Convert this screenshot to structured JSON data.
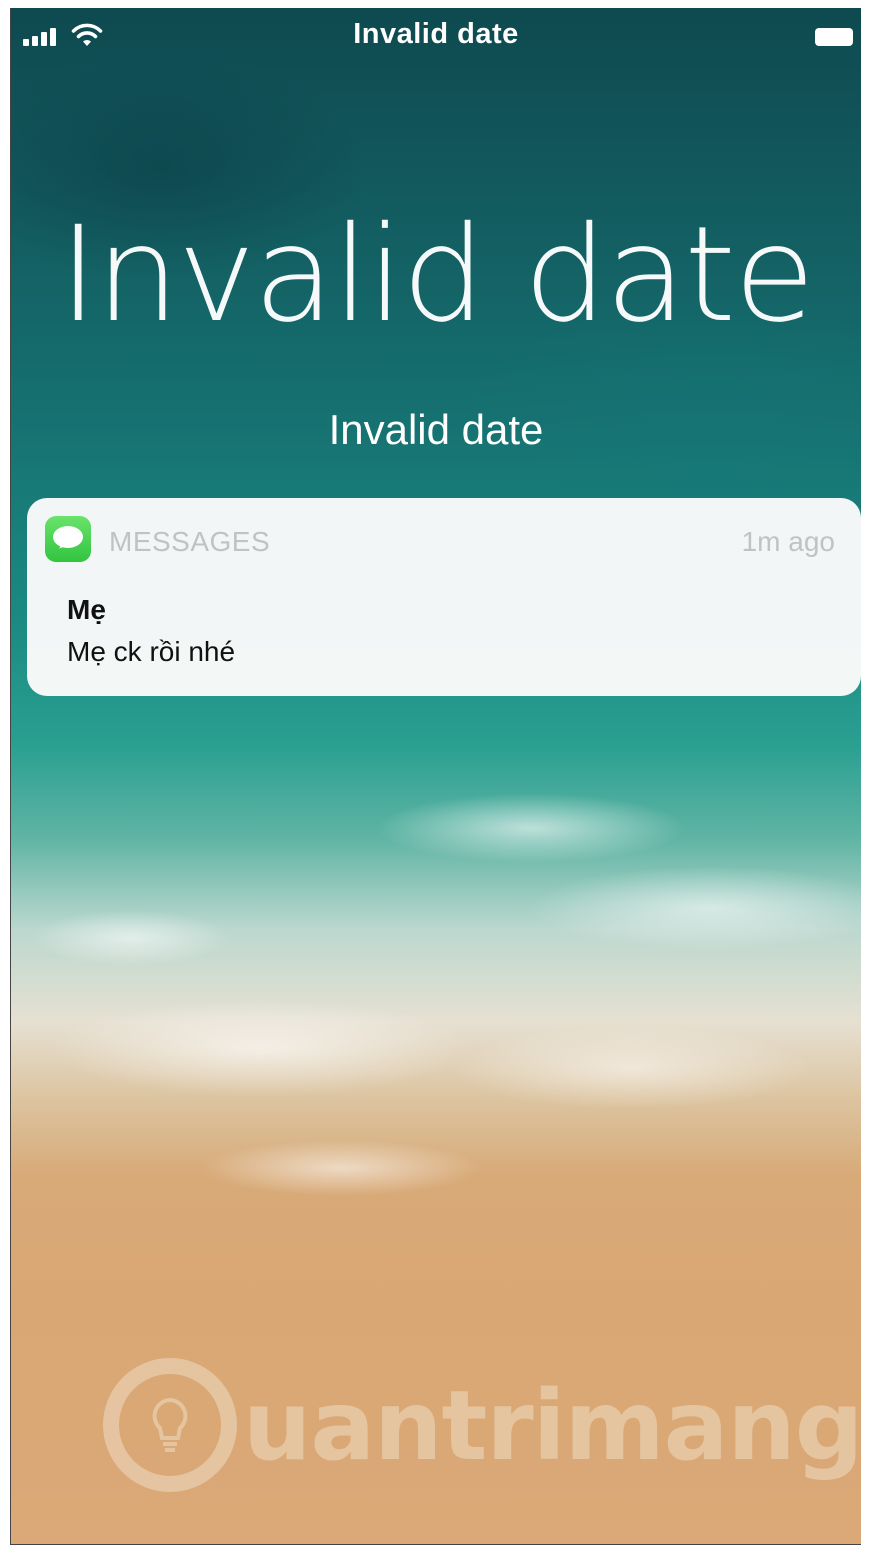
{
  "status_bar": {
    "time": "Invalid date",
    "signal_icon": "cellular-signal-icon",
    "wifi_icon": "wifi-icon",
    "battery_icon": "battery-icon"
  },
  "lock_screen": {
    "clock": "Invalid date",
    "date": "Invalid date"
  },
  "notification": {
    "app_icon": "messages-app-icon",
    "app_name": "MESSAGES",
    "time_ago": "1m ago",
    "sender": "Mẹ",
    "body": "Mẹ ck rồi nhé"
  },
  "watermark": {
    "text": "uantrimang",
    "icon": "lightbulb-logo-icon"
  },
  "colors": {
    "app_icon_green": "#31c43f",
    "notification_bg": "#fafafa",
    "muted_text": "#c2c2c2"
  }
}
